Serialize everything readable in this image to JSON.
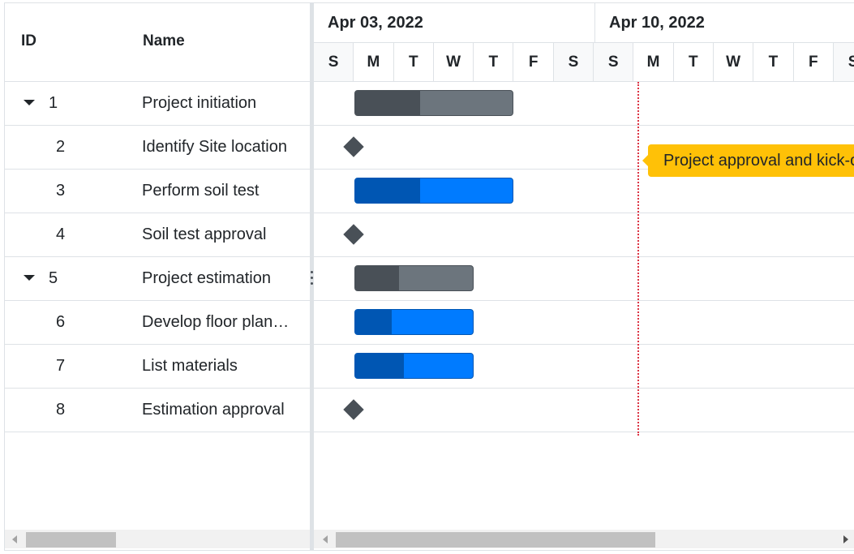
{
  "grid": {
    "columns": {
      "id": "ID",
      "name": "Name"
    },
    "rows": [
      {
        "id": "1",
        "name": "Project initiation",
        "expandable": true
      },
      {
        "id": "2",
        "name": "Identify Site location",
        "expandable": false
      },
      {
        "id": "3",
        "name": "Perform soil test",
        "expandable": false
      },
      {
        "id": "4",
        "name": "Soil test approval",
        "expandable": false
      },
      {
        "id": "5",
        "name": "Project estimation",
        "expandable": true
      },
      {
        "id": "6",
        "name": "Develop floor plan for estimation",
        "expandable": false
      },
      {
        "id": "7",
        "name": "List materials",
        "expandable": false
      },
      {
        "id": "8",
        "name": "Estimation approval",
        "expandable": false
      }
    ]
  },
  "timeline": {
    "weeks": [
      "Apr 03, 2022",
      "Apr 10, 2022"
    ],
    "days": [
      "S",
      "M",
      "T",
      "W",
      "T",
      "F",
      "S",
      "S",
      "M",
      "T",
      "W",
      "T",
      "F",
      "S"
    ]
  },
  "tasks": [
    {
      "type": "parent",
      "start_day": 1,
      "duration_days": 4,
      "progress": 0.41
    },
    {
      "type": "milestone",
      "start_day": 1
    },
    {
      "type": "child",
      "start_day": 1,
      "duration_days": 4,
      "progress": 0.41
    },
    {
      "type": "milestone",
      "start_day": 1
    },
    {
      "type": "parent",
      "start_day": 1,
      "duration_days": 3,
      "progress": 0.37
    },
    {
      "type": "child",
      "start_day": 1,
      "duration_days": 3,
      "progress": 0.31
    },
    {
      "type": "child",
      "start_day": 1,
      "duration_days": 3,
      "progress": 0.41
    },
    {
      "type": "milestone",
      "start_day": 1
    }
  ],
  "event_marker": {
    "label": "Project approval and kick-off",
    "day": 7
  },
  "colors": {
    "parent_bar": "#6c757d",
    "parent_progress": "#495057",
    "child_bar": "#007bff",
    "child_progress": "#0056b3",
    "milestone": "#495057",
    "event_marker": "#ffc107",
    "today_line": "#dc3545"
  }
}
